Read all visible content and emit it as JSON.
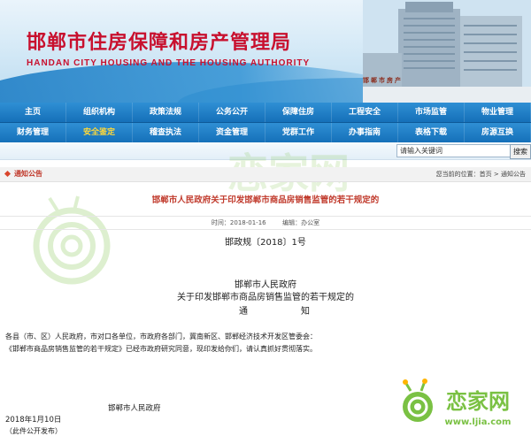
{
  "header": {
    "title": "邯郸市住房保障和房产管理局",
    "subtitle": "HANDAN CITY HOUSING AND THE HOUSING AUTHORITY",
    "building_sign": "邯郸市房产"
  },
  "nav": {
    "row1": [
      "主页",
      "组织机构",
      "政策法规",
      "公务公开",
      "保障住房",
      "工程安全",
      "市场监管",
      "物业管理"
    ],
    "row2": [
      "财务管理",
      "安全鉴定",
      "稽查执法",
      "资金管理",
      "党群工作",
      "办事指南",
      "表格下载",
      "房源互换"
    ],
    "active_row2_index": 1
  },
  "search": {
    "placeholder": "请输入关键词",
    "button_label": "搜索"
  },
  "section": {
    "label": "通知公告",
    "breadcrumb": "您当前的位置：首页 > 通知公告"
  },
  "article": {
    "title": "邯郸市人民政府关于印发邯郸市商品房销售监管的若干规定的",
    "time_label": "时间：2018-01-16",
    "editor_label": "编辑：办公室",
    "doc_number": "邯政规〔2018〕1号",
    "org": "邯郸市人民政府",
    "notice_title": "关于印发邯郸市商品房销售监管的若干规定的",
    "notice_word_1": "通",
    "notice_word_2": "知",
    "body_1": "各县（市、区）人民政府，市对口各单位，市政府各部门，冀南新区、邯郸经济技术开发区管委会：",
    "body_2": "《邯郸市商品房销售监管的若干规定》已经市政府研究同意，现印发给你们，请认真抓好贯彻落实。",
    "sign_org": "邯郸市人民政府",
    "sign_date": "2018年1月10日",
    "cut_line": "（此件公开发布）"
  },
  "watermark": {
    "brand": "恋家网",
    "url": "www.ljia.com"
  },
  "colors": {
    "title_red": "#c8102e",
    "nav_blue": "#1570b9",
    "nav_active": "#ffd83a",
    "article_title": "#c0392b",
    "brand_green": "#7ac143"
  }
}
